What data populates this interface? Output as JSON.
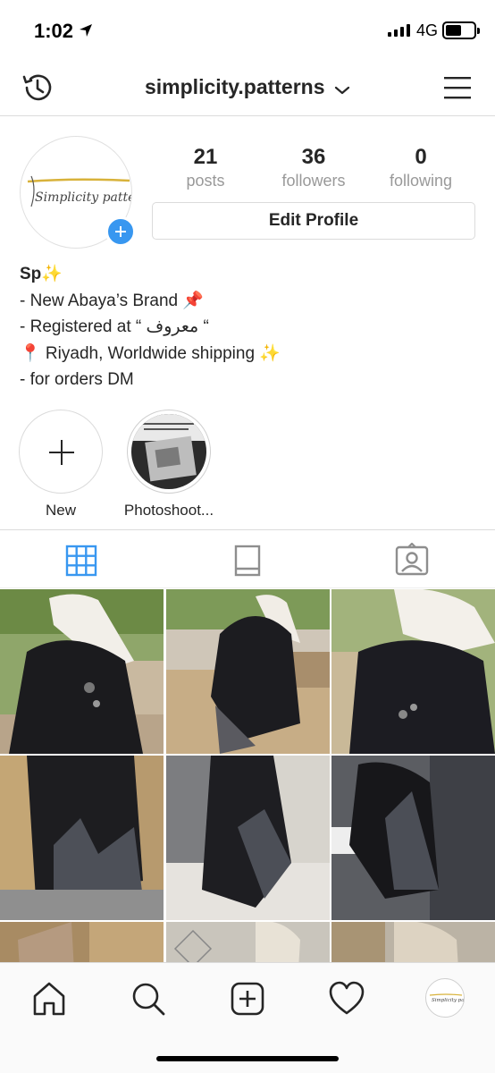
{
  "status_bar": {
    "time": "1:02",
    "network": "4G",
    "battery_level": 0.55
  },
  "header": {
    "username": "simplicity.patterns",
    "icons": [
      "history-icon",
      "chevron-down-icon",
      "menu-icon"
    ]
  },
  "profile": {
    "avatar_text": "Simplicity patterns",
    "stats": [
      {
        "number": "21",
        "label": "posts"
      },
      {
        "number": "36",
        "label": "followers"
      },
      {
        "number": "0",
        "label": "following"
      }
    ],
    "edit_button": "Edit Profile",
    "bio": {
      "name": "Sp✨",
      "lines": [
        "- New Abaya’s Brand 📌",
        "- Registered at “ معروف “",
        "📍 Riyadh, Worldwide shipping ✨",
        "- for orders DM"
      ]
    }
  },
  "highlights": [
    {
      "label": "New"
    },
    {
      "label": "Photoshoot..."
    }
  ],
  "tabs": [
    {
      "name": "grid",
      "active": true
    },
    {
      "name": "feed",
      "active": false
    },
    {
      "name": "tagged",
      "active": false
    }
  ],
  "colors": {
    "accent": "#3897f0",
    "text": "#262626",
    "muted": "#999999",
    "border": "#dbdbdb"
  },
  "bottom_nav": [
    "home-icon",
    "search-icon",
    "add-post-icon",
    "heart-icon",
    "profile-avatar"
  ]
}
